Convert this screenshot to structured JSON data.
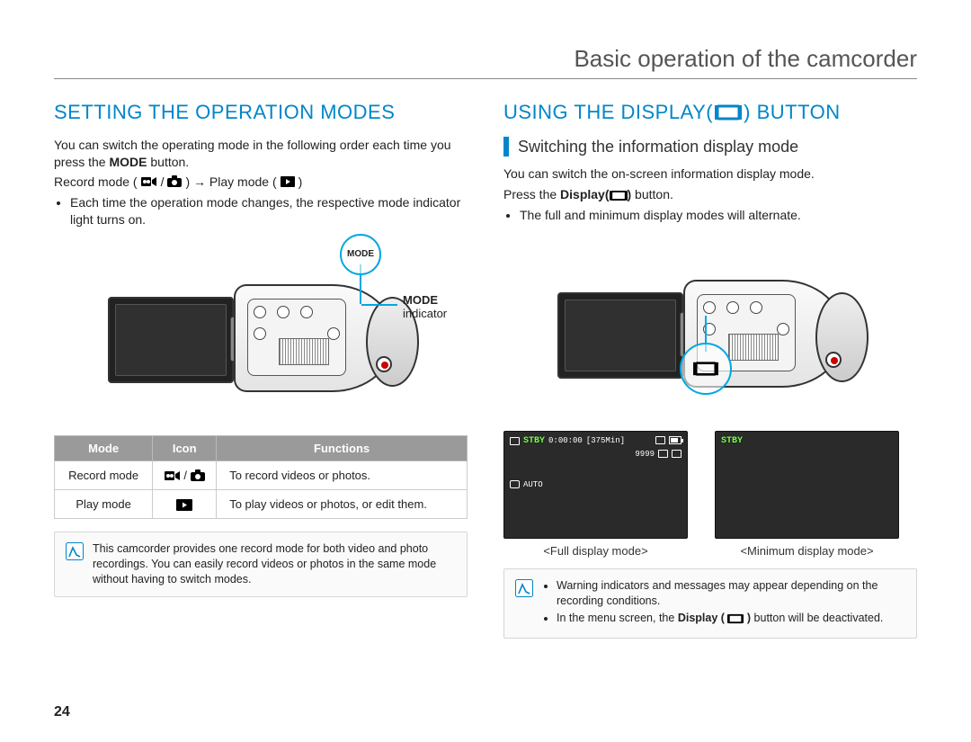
{
  "chapter_title": "Basic operation of the camcorder",
  "page_number": "24",
  "left": {
    "heading": "SETTING THE OPERATION MODES",
    "intro1": "You can switch the operating mode in the following order each time you press the ",
    "intro_bold": "MODE",
    "intro2": " button.",
    "mode_line_record": "Record mode (",
    "mode_line_sep": " / ",
    "mode_line_close_arrow": " ) → Play mode ( ",
    "mode_line_end": " )",
    "bullet1": "Each time the operation mode changes, the respective mode indicator light turns on.",
    "callout_mode_btn": "MODE",
    "callout_label_bold": "MODE",
    "callout_label_rest": "indicator",
    "table": {
      "headers": [
        "Mode",
        "Icon",
        "Functions"
      ],
      "rows": [
        {
          "mode": "Record mode",
          "icon_name": "video-and-photo",
          "fn": "To record videos or photos."
        },
        {
          "mode": "Play mode",
          "icon_name": "play-rect",
          "fn": "To play videos or photos, or edit them."
        }
      ]
    },
    "note_text": "This camcorder provides one record mode for both video and photo recordings. You can easily record videos or photos in the same mode without having to switch modes."
  },
  "right": {
    "heading": "USING THE DISPLAY(        ) BUTTON",
    "subheading": "Switching the information display mode",
    "p1": "You can switch the on-screen information display mode.",
    "p2a": "Press the ",
    "p2b_bold": "Display(",
    "p2c_bold_after": ")",
    "p2d": " button.",
    "bullet1": "The full and minimum display modes will alternate.",
    "preview_full": {
      "stby": "STBY",
      "time": "0:00:00",
      "remain": "[375Min]",
      "counter": "9999",
      "auto": "AUTO",
      "caption": "<Full display mode>"
    },
    "preview_min": {
      "stby": "STBY",
      "caption": "<Minimum display mode>"
    },
    "note_items": [
      "Warning indicators and messages may appear depending on the recording conditions.",
      "In the menu screen, the Display (        ) button will be deactivated."
    ],
    "note_item2_pre": "In the menu screen, the ",
    "note_item2_bold": "Display (",
    "note_item2_post": ") button will be deactivated."
  }
}
